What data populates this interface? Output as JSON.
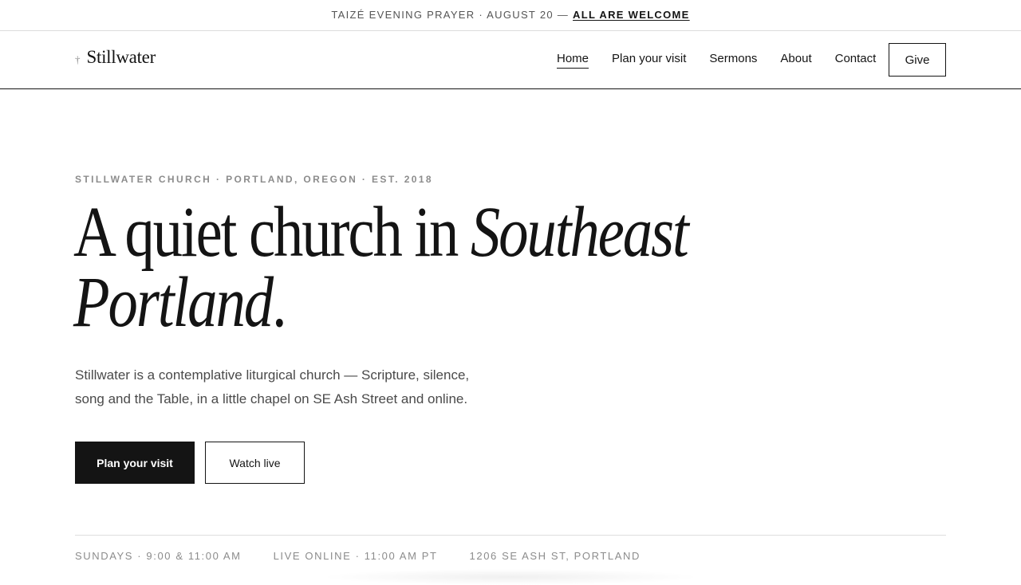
{
  "announcement": {
    "text": "Taizé Evening Prayer · August 20 —",
    "link": "All are welcome"
  },
  "header": {
    "logo_mark": "†",
    "logo_text": "Stillwater",
    "nav": [
      {
        "label": "Home",
        "active": true
      },
      {
        "label": "Plan your visit",
        "active": false
      },
      {
        "label": "Sermons",
        "active": false
      },
      {
        "label": "About",
        "active": false
      },
      {
        "label": "Contact",
        "active": false
      }
    ],
    "give_label": "Give"
  },
  "hero": {
    "eyebrow": "Stillwater Church · Portland, Oregon · Est. 2018",
    "headline_plain": "A quiet church in ",
    "headline_italic": "Southeast Portland",
    "headline_end": ".",
    "lede": "Stillwater is a contemplative liturgical church — Scripture, silence, song and the Table, in a little chapel on SE Ash Street and online.",
    "primary_cta": "Plan your visit",
    "secondary_cta": "Watch live"
  },
  "info": {
    "sundays": "Sundays · 9:00 & 11:00 AM",
    "live": "Live online · 11:00 AM PT",
    "address": "1206 SE Ash St, Portland"
  },
  "colors": {
    "ink": "#141414",
    "muted": "#8c8c8c",
    "background": "#ffffff"
  }
}
